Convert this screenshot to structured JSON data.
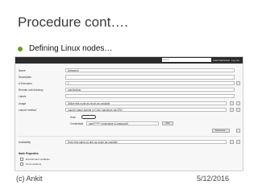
{
  "slide": {
    "title": "Procedure cont….",
    "bullet": "Defining Linux nodes…",
    "footer_left": "(c) Ankit",
    "footer_right": "5/12/2016"
  },
  "topbar": {
    "search_placeholder": "Search",
    "user": "Ankit Nakhotkar",
    "logout": "Log out"
  },
  "form": {
    "fields": [
      {
        "label": "Name",
        "value": "Debeenin"
      },
      {
        "label": "Description",
        "value": ""
      },
      {
        "label": "# Executors",
        "value": "1"
      },
      {
        "label": "Remote root directory",
        "value": "/var/jenkins"
      },
      {
        "label": "Labels",
        "value": ""
      },
      {
        "label": "Usage",
        "value": "Utilize this node as much as possible"
      },
      {
        "label": "Launch method",
        "value": "Launch slave agents on Unix machines via SSH"
      },
      {
        "label": "Host",
        "value": ""
      },
      {
        "label": "Credentials",
        "value": "user/****** (username & password)"
      },
      {
        "label": "Availability",
        "value": "Keep this slave on-line as much as possible"
      }
    ],
    "add_button": "Add",
    "advanced_button": "Advanced...",
    "node_properties_label": "Node Properties",
    "properties": [
      {
        "label": "Environment variables"
      },
      {
        "label": "Tool Locations"
      }
    ]
  }
}
